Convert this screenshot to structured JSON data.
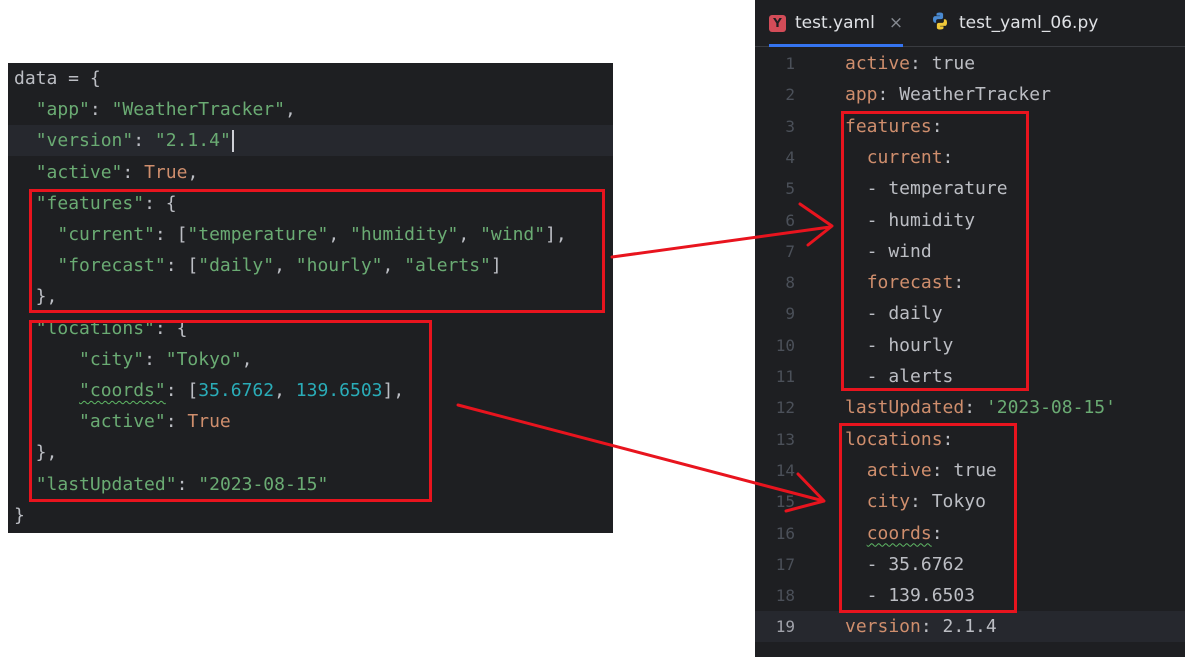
{
  "python_snippet": {
    "lines": [
      [
        {
          "t": "data = {",
          "c": "plain"
        }
      ],
      [
        {
          "t": "  ",
          "c": "plain"
        },
        {
          "t": "\"app\"",
          "c": "str"
        },
        {
          "t": ": ",
          "c": "plain"
        },
        {
          "t": "\"WeatherTracker\"",
          "c": "str"
        },
        {
          "t": ",",
          "c": "plain"
        }
      ],
      [
        {
          "t": "  ",
          "c": "plain"
        },
        {
          "t": "\"version\"",
          "c": "str"
        },
        {
          "t": ": ",
          "c": "plain"
        },
        {
          "t": "\"2.1.4\"",
          "c": "str"
        }
      ],
      [
        {
          "t": "  ",
          "c": "plain"
        },
        {
          "t": "\"active\"",
          "c": "str"
        },
        {
          "t": ": ",
          "c": "plain"
        },
        {
          "t": "True",
          "c": "kw"
        },
        {
          "t": ",",
          "c": "plain"
        }
      ],
      [
        {
          "t": "  ",
          "c": "plain"
        },
        {
          "t": "\"features\"",
          "c": "str"
        },
        {
          "t": ": {",
          "c": "plain"
        }
      ],
      [
        {
          "t": "    ",
          "c": "plain"
        },
        {
          "t": "\"current\"",
          "c": "str"
        },
        {
          "t": ": [",
          "c": "plain"
        },
        {
          "t": "\"temperature\"",
          "c": "str"
        },
        {
          "t": ", ",
          "c": "plain"
        },
        {
          "t": "\"humidity\"",
          "c": "str"
        },
        {
          "t": ", ",
          "c": "plain"
        },
        {
          "t": "\"wind\"",
          "c": "str"
        },
        {
          "t": "],",
          "c": "plain"
        }
      ],
      [
        {
          "t": "    ",
          "c": "plain"
        },
        {
          "t": "\"forecast\"",
          "c": "str"
        },
        {
          "t": ": [",
          "c": "plain"
        },
        {
          "t": "\"daily\"",
          "c": "str"
        },
        {
          "t": ", ",
          "c": "plain"
        },
        {
          "t": "\"hourly\"",
          "c": "str"
        },
        {
          "t": ", ",
          "c": "plain"
        },
        {
          "t": "\"alerts\"",
          "c": "str"
        },
        {
          "t": "]",
          "c": "plain"
        }
      ],
      [
        {
          "t": "  },",
          "c": "plain"
        }
      ],
      [
        {
          "t": "  ",
          "c": "plain"
        },
        {
          "t": "\"locations\"",
          "c": "str"
        },
        {
          "t": ": {",
          "c": "plain"
        }
      ],
      [
        {
          "t": "      ",
          "c": "plain"
        },
        {
          "t": "\"city\"",
          "c": "str"
        },
        {
          "t": ": ",
          "c": "plain"
        },
        {
          "t": "\"Tokyo\"",
          "c": "str"
        },
        {
          "t": ",",
          "c": "plain"
        }
      ],
      [
        {
          "t": "      ",
          "c": "plain"
        },
        {
          "t": "\"coords\"",
          "c": "str",
          "sq": true
        },
        {
          "t": ": [",
          "c": "plain"
        },
        {
          "t": "35.6762",
          "c": "num"
        },
        {
          "t": ", ",
          "c": "plain"
        },
        {
          "t": "139.6503",
          "c": "num"
        },
        {
          "t": "],",
          "c": "plain"
        }
      ],
      [
        {
          "t": "      ",
          "c": "plain"
        },
        {
          "t": "\"active\"",
          "c": "str"
        },
        {
          "t": ": ",
          "c": "plain"
        },
        {
          "t": "True",
          "c": "kw"
        }
      ],
      [
        {
          "t": "  },",
          "c": "plain"
        }
      ],
      [
        {
          "t": "  ",
          "c": "plain"
        },
        {
          "t": "\"lastUpdated\"",
          "c": "str"
        },
        {
          "t": ": ",
          "c": "plain"
        },
        {
          "t": "\"2023-08-15\"",
          "c": "str"
        }
      ],
      [
        {
          "t": "}",
          "c": "plain"
        }
      ]
    ],
    "caret_line": 2
  },
  "editor": {
    "tabs": [
      {
        "label": "test.yaml",
        "icon": "yaml-file-icon",
        "icon_glyph": "Y",
        "close": "×",
        "active": true
      },
      {
        "label": "test_yaml_06.py",
        "icon": "python-file-icon",
        "active": false
      }
    ],
    "current_line": 19,
    "lines": [
      {
        "n": "1",
        "tokens": [
          {
            "t": "active",
            "c": "key"
          },
          {
            "t": ": true",
            "c": "plain"
          }
        ]
      },
      {
        "n": "2",
        "tokens": [
          {
            "t": "app",
            "c": "key"
          },
          {
            "t": ": WeatherTracker",
            "c": "plain"
          }
        ]
      },
      {
        "n": "3",
        "tokens": [
          {
            "t": "features",
            "c": "key"
          },
          {
            "t": ":",
            "c": "plain"
          }
        ]
      },
      {
        "n": "4",
        "tokens": [
          {
            "t": "  ",
            "c": "plain"
          },
          {
            "t": "current",
            "c": "key"
          },
          {
            "t": ":",
            "c": "plain"
          }
        ]
      },
      {
        "n": "5",
        "tokens": [
          {
            "t": "  - temperature",
            "c": "plain"
          }
        ]
      },
      {
        "n": "6",
        "tokens": [
          {
            "t": "  - humidity",
            "c": "plain"
          }
        ]
      },
      {
        "n": "7",
        "tokens": [
          {
            "t": "  - wind",
            "c": "plain"
          }
        ]
      },
      {
        "n": "8",
        "tokens": [
          {
            "t": "  ",
            "c": "plain"
          },
          {
            "t": "forecast",
            "c": "key"
          },
          {
            "t": ":",
            "c": "plain"
          }
        ]
      },
      {
        "n": "9",
        "tokens": [
          {
            "t": "  - daily",
            "c": "plain"
          }
        ]
      },
      {
        "n": "10",
        "tokens": [
          {
            "t": "  - hourly",
            "c": "plain"
          }
        ]
      },
      {
        "n": "11",
        "tokens": [
          {
            "t": "  - alerts",
            "c": "plain"
          }
        ]
      },
      {
        "n": "12",
        "tokens": [
          {
            "t": "lastUpdated",
            "c": "key"
          },
          {
            "t": ": ",
            "c": "plain"
          },
          {
            "t": "'2023-08-15'",
            "c": "str"
          }
        ]
      },
      {
        "n": "13",
        "tokens": [
          {
            "t": "locations",
            "c": "key"
          },
          {
            "t": ":",
            "c": "plain"
          }
        ]
      },
      {
        "n": "14",
        "tokens": [
          {
            "t": "  ",
            "c": "plain"
          },
          {
            "t": "active",
            "c": "key"
          },
          {
            "t": ": true",
            "c": "plain"
          }
        ]
      },
      {
        "n": "15",
        "tokens": [
          {
            "t": "  ",
            "c": "plain"
          },
          {
            "t": "city",
            "c": "key"
          },
          {
            "t": ": Tokyo",
            "c": "plain"
          }
        ]
      },
      {
        "n": "16",
        "tokens": [
          {
            "t": "  ",
            "c": "plain"
          },
          {
            "t": "coords",
            "c": "key",
            "sq": true
          },
          {
            "t": ":",
            "c": "plain"
          }
        ]
      },
      {
        "n": "17",
        "tokens": [
          {
            "t": "  - 35.6762",
            "c": "plain"
          }
        ]
      },
      {
        "n": "18",
        "tokens": [
          {
            "t": "  - 139.6503",
            "c": "plain"
          }
        ]
      },
      {
        "n": "19",
        "tokens": [
          {
            "t": "version",
            "c": "key"
          },
          {
            "t": ": 2.1.4",
            "c": "plain"
          }
        ]
      }
    ]
  },
  "colors": {
    "annotation_red": "#e8141e",
    "editor_bg": "#1e1f22",
    "string": "#6aab73",
    "number": "#2aacb8",
    "keyword": "#cf8e6d"
  }
}
